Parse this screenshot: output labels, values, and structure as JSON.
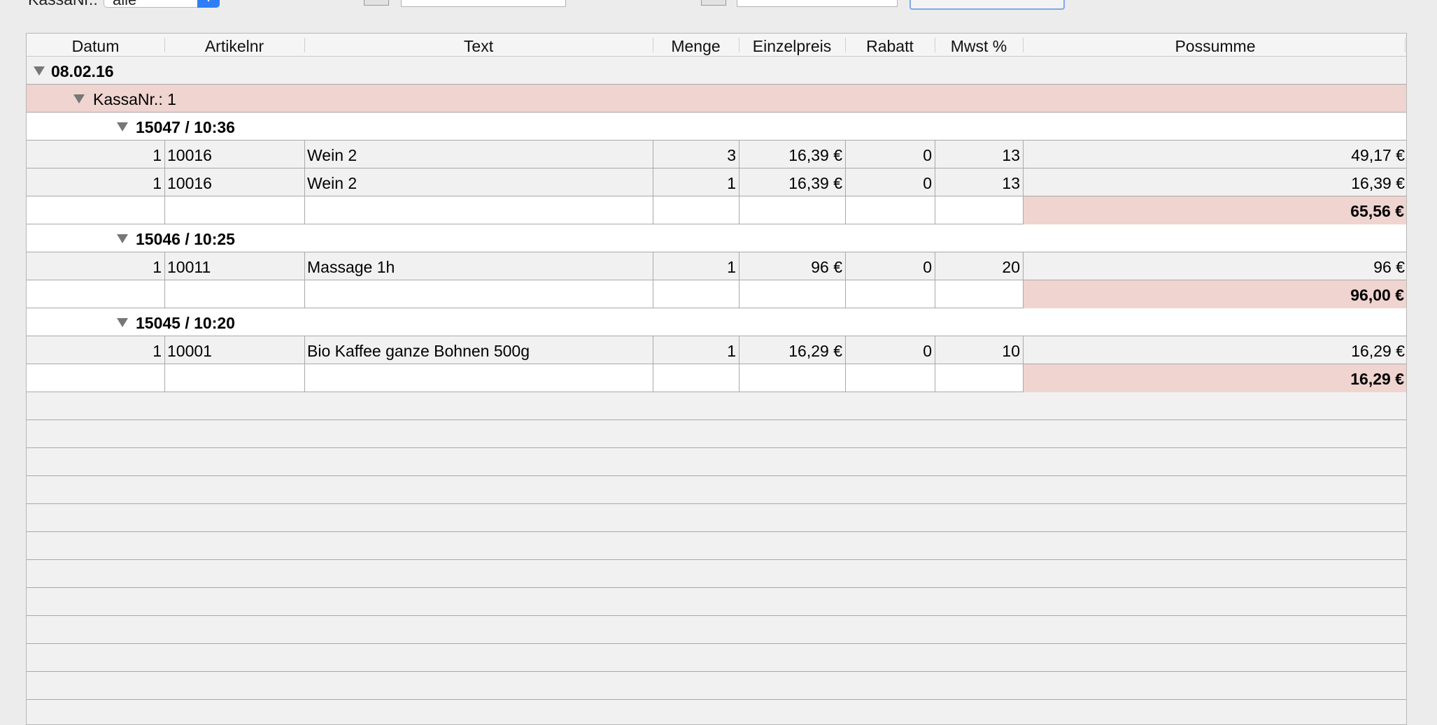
{
  "toolbar": {
    "kasse_label": "KassaNr.:",
    "kasse_value": "alle"
  },
  "table": {
    "columns": [
      "Datum",
      "Artikelnr",
      "Text",
      "Menge",
      "Einzelpreis",
      "Rabatt",
      "Mwst %",
      "Possumme"
    ],
    "date_group": "08.02.16",
    "kasse_group": "KassaNr.: 1",
    "receipts": [
      {
        "title": "15047 / 10:36",
        "items": [
          {
            "datum": "1",
            "artikelnr": "10016",
            "text": "Wein 2",
            "menge": "3",
            "einzelpreis": "16,39 €",
            "rabatt": "0",
            "mwst": "13",
            "possumme": "49,17 €"
          },
          {
            "datum": "1",
            "artikelnr": "10016",
            "text": "Wein 2",
            "menge": "1",
            "einzelpreis": "16,39 €",
            "rabatt": "0",
            "mwst": "13",
            "possumme": "16,39 €"
          }
        ],
        "total": "65,56 €"
      },
      {
        "title": "15046 / 10:25",
        "items": [
          {
            "datum": "1",
            "artikelnr": "10011",
            "text": "Massage 1h",
            "menge": "1",
            "einzelpreis": "96 €",
            "rabatt": "0",
            "mwst": "20",
            "possumme": "96 €"
          }
        ],
        "total": "96,00 €"
      },
      {
        "title": "15045 / 10:20",
        "items": [
          {
            "datum": "1",
            "artikelnr": "10001",
            "text": "Bio Kaffee ganze Bohnen 500g",
            "menge": "1",
            "einzelpreis": "16,29 €",
            "rabatt": "0",
            "mwst": "10",
            "possumme": "16,29 €"
          }
        ],
        "total": "16,29 €"
      }
    ]
  },
  "colors": {
    "group_pink": "#efd4d0",
    "select_accent": "#2f7ef5"
  }
}
